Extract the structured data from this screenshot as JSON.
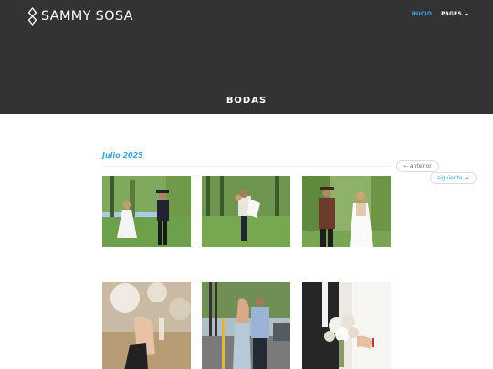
{
  "site": {
    "brand": "SAMMY SOSA",
    "page_title": "BODAS"
  },
  "nav": [
    {
      "label": "INICIO",
      "active": true
    },
    {
      "label": "PAGES",
      "active": false,
      "dropdown": true
    }
  ],
  "archive": {
    "heading": "Julio 2025"
  },
  "pager": {
    "prev_label": "← anterior",
    "next_label": "siguiente →"
  },
  "colors": {
    "header_bg": "#333333",
    "accent": "#3aa3d8"
  },
  "gallery_icons": [
    "wedding-photo-dance",
    "wedding-photo-dip",
    "wedding-photo-hands",
    "wedding-photo-toast",
    "wedding-photo-embrace",
    "wedding-photo-bouquet"
  ]
}
